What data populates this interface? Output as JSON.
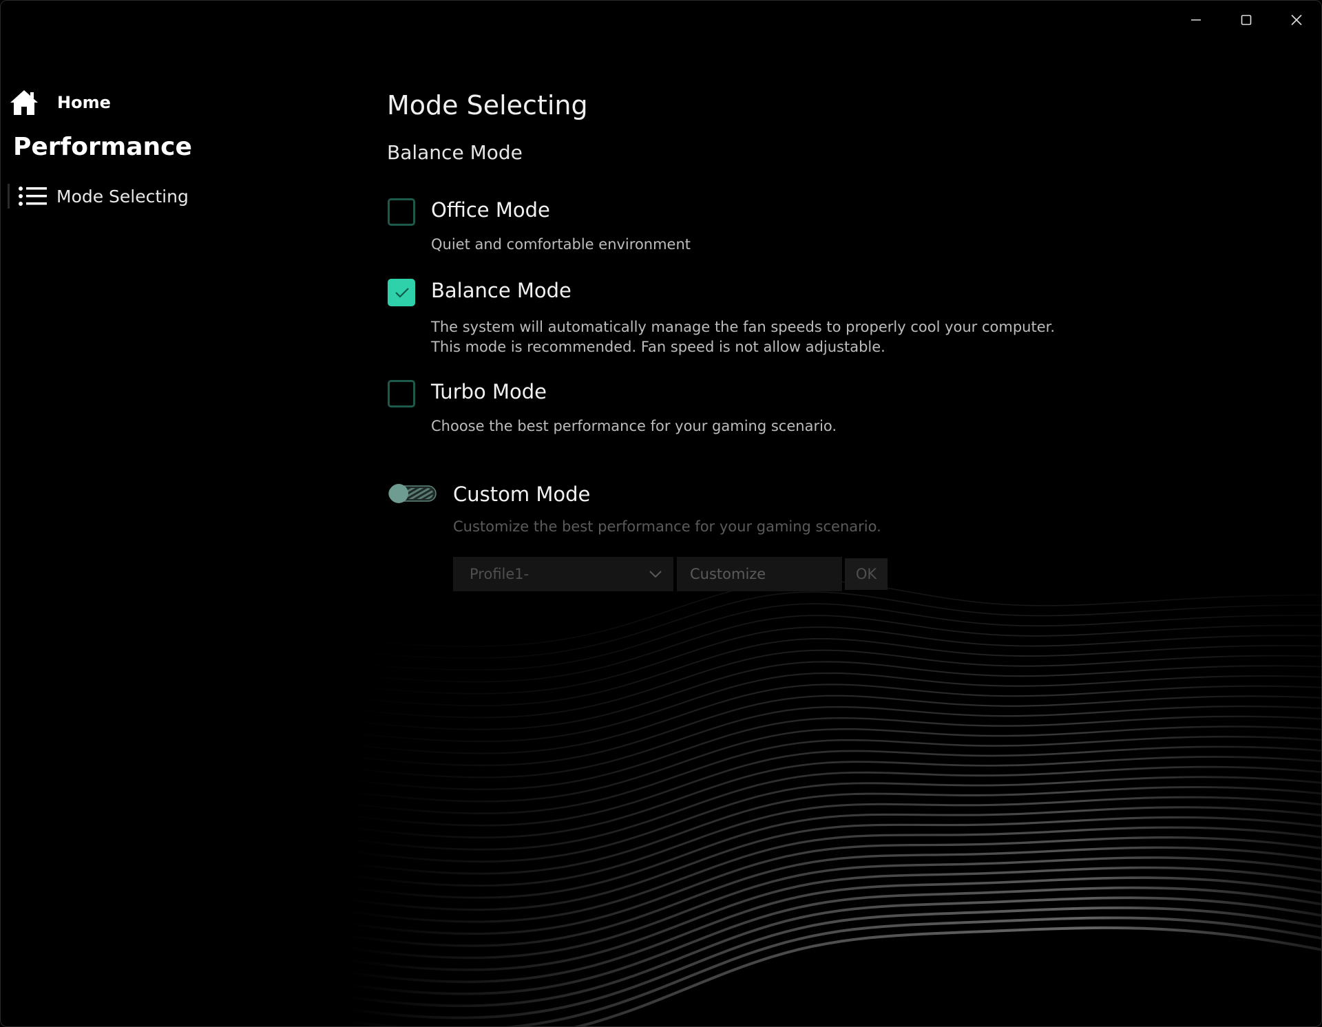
{
  "window": {
    "controls": {
      "minimize_icon": "minimize-icon",
      "maximize_icon": "maximize-icon",
      "close_icon": "close-icon"
    }
  },
  "sidebar": {
    "home_label": "Home",
    "home_icon": "home-icon",
    "section_title": "Performance",
    "items": [
      {
        "label": "Mode Selecting",
        "icon": "list-icon",
        "selected": true
      }
    ]
  },
  "main": {
    "title": "Mode Selecting",
    "current_mode": "Balance Mode",
    "options": [
      {
        "title": "Office Mode",
        "checked": false,
        "description": [
          "Quiet and comfortable environment"
        ]
      },
      {
        "title": "Balance Mode",
        "checked": true,
        "description": [
          "The system will automatically manage the fan speeds to properly cool your computer.",
          "This mode is recommended. Fan speed is not allow adjustable."
        ]
      },
      {
        "title": "Turbo Mode",
        "checked": false,
        "description": [
          "Choose the best performance for your gaming scenario."
        ]
      }
    ],
    "custom": {
      "title": "Custom Mode",
      "enabled": false,
      "description": "Customize the best performance for your gaming scenario.",
      "profile_value": "Profile1-",
      "customize_placeholder": "Customize",
      "ok_label": "OK"
    }
  },
  "colors": {
    "accent": "#2fd1ab",
    "checkbox_border": "#1d5a4c",
    "background": "#000000"
  }
}
